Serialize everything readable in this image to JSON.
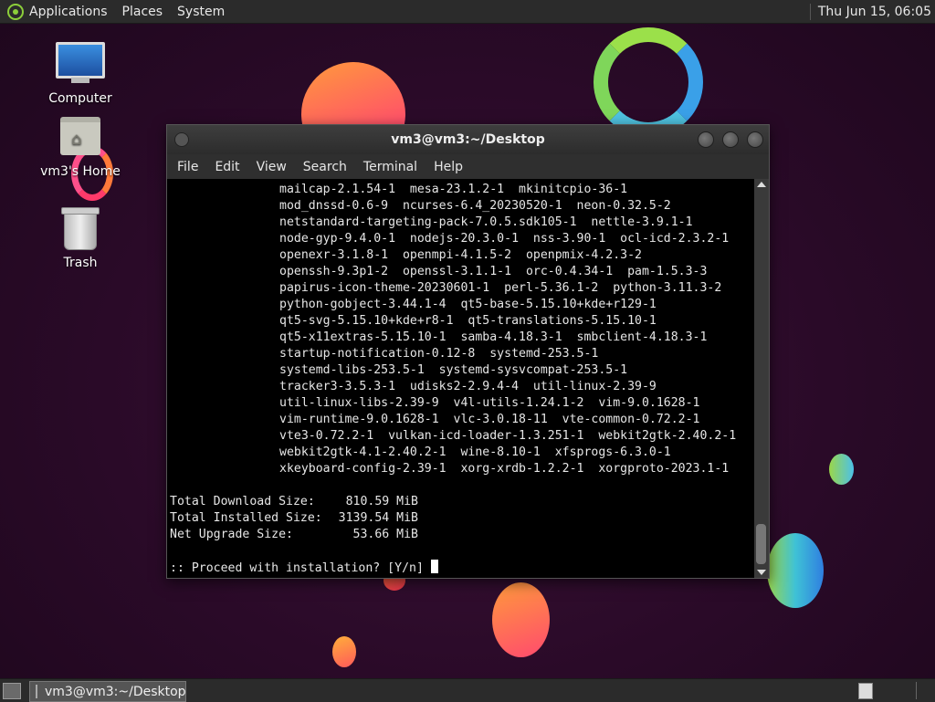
{
  "top_panel": {
    "menus": [
      "Applications",
      "Places",
      "System"
    ],
    "clock": "Thu Jun 15, 06:05"
  },
  "desktop": {
    "icons": [
      {
        "label": "Computer",
        "icon": "computer-icon"
      },
      {
        "label": "vm3's Home",
        "icon": "home-folder-icon"
      },
      {
        "label": "Trash",
        "icon": "trash-icon"
      }
    ]
  },
  "terminal": {
    "title": "vm3@vm3:~/Desktop",
    "menu": [
      "File",
      "Edit",
      "View",
      "Search",
      "Terminal",
      "Help"
    ],
    "package_lines": [
      "mailcap-2.1.54-1  mesa-23.1.2-1  mkinitcpio-36-1",
      "mod_dnssd-0.6-9  ncurses-6.4_20230520-1  neon-0.32.5-2",
      "netstandard-targeting-pack-7.0.5.sdk105-1  nettle-3.9.1-1",
      "node-gyp-9.4.0-1  nodejs-20.3.0-1  nss-3.90-1  ocl-icd-2.3.2-1",
      "openexr-3.1.8-1  openmpi-4.1.5-2  openpmix-4.2.3-2",
      "openssh-9.3p1-2  openssl-3.1.1-1  orc-0.4.34-1  pam-1.5.3-3",
      "papirus-icon-theme-20230601-1  perl-5.36.1-2  python-3.11.3-2",
      "python-gobject-3.44.1-4  qt5-base-5.15.10+kde+r129-1",
      "qt5-svg-5.15.10+kde+r8-1  qt5-translations-5.15.10-1",
      "qt5-x11extras-5.15.10-1  samba-4.18.3-1  smbclient-4.18.3-1",
      "startup-notification-0.12-8  systemd-253.5-1",
      "systemd-libs-253.5-1  systemd-sysvcompat-253.5-1",
      "tracker3-3.5.3-1  udisks2-2.9.4-4  util-linux-2.39-9",
      "util-linux-libs-2.39-9  v4l-utils-1.24.1-2  vim-9.0.1628-1",
      "vim-runtime-9.0.1628-1  vlc-3.0.18-11  vte-common-0.72.2-1",
      "vte3-0.72.2-1  vulkan-icd-loader-1.3.251-1  webkit2gtk-2.40.2-1",
      "webkit2gtk-4.1-2.40.2-1  wine-8.10-1  xfsprogs-6.3.0-1",
      "xkeyboard-config-2.39-1  xorg-xrdb-1.2.2-1  xorgproto-2023.1-1"
    ],
    "summary": [
      {
        "label": "Total Download Size:",
        "value": "810.59 MiB"
      },
      {
        "label": "Total Installed Size:",
        "value": "3139.54 MiB"
      },
      {
        "label": "Net Upgrade Size:",
        "value": "53.66 MiB"
      }
    ],
    "prompt": ":: Proceed with installation? [Y/n] "
  },
  "taskbar": {
    "window_button": "vm3@vm3:~/Desktop"
  }
}
